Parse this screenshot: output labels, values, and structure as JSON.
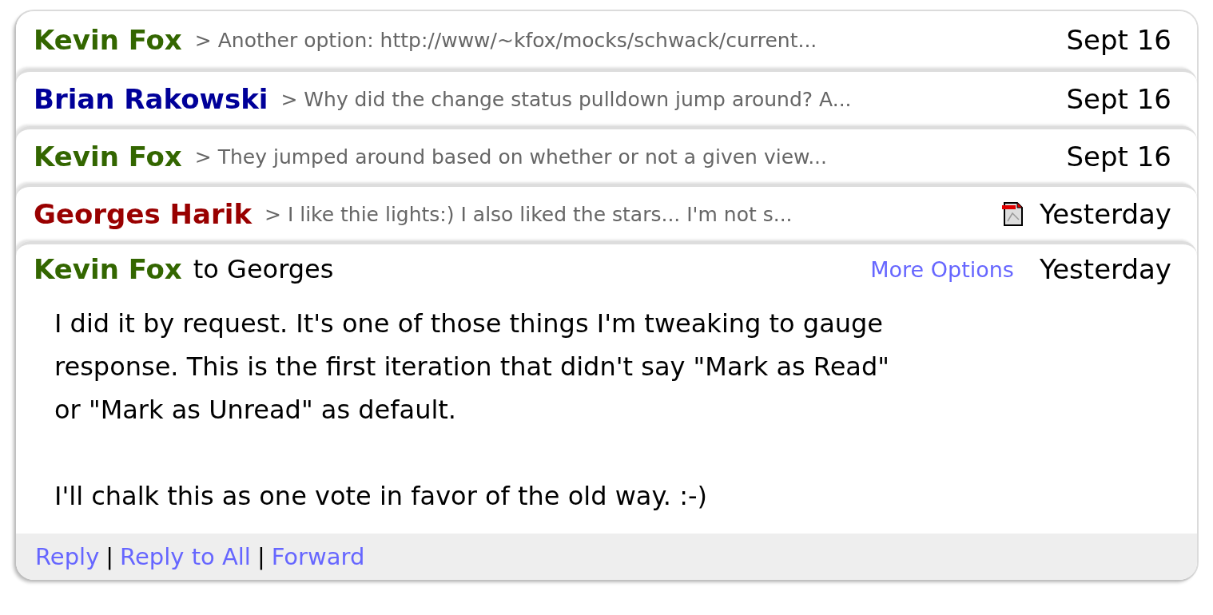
{
  "conversation": [
    {
      "sender": "Kevin Fox",
      "color": "#336600",
      "snippet": "> Another option: http://www/~kfox/mocks/schwack/current...",
      "attachment": false,
      "date": "Sept 16"
    },
    {
      "sender": "Brian Rakowski",
      "color": "#000099",
      "snippet": "> Why did the change status pulldown jump around? A...",
      "attachment": false,
      "date": "Sept 16"
    },
    {
      "sender": "Kevin Fox",
      "color": "#336600",
      "snippet": "> They jumped around based on whether or not a given view...",
      "attachment": false,
      "date": "Sept 16"
    },
    {
      "sender": "Georges Harik",
      "color": "#990000",
      "snippet": "> I like thie lights:) I also liked the stars... I'm not s...",
      "attachment": true,
      "date": "Yesterday"
    }
  ],
  "open_message": {
    "sender": "Kevin Fox",
    "color": "#336600",
    "recipient": "to Georges",
    "more_options": "More Options",
    "date": "Yesterday",
    "paragraphs": [
      "I did it by request. It's one of those things I'm tweaking to gauge\nresponse. This is the first iteration that didn't say \"Mark as Read\"\nor \"Mark as Unread\" as default.",
      "I'll chalk this as one vote in favor of the old way. :-)"
    ],
    "actions": [
      "Reply",
      "Reply to All",
      "Forward"
    ],
    "separators": [
      "|",
      "|"
    ]
  }
}
